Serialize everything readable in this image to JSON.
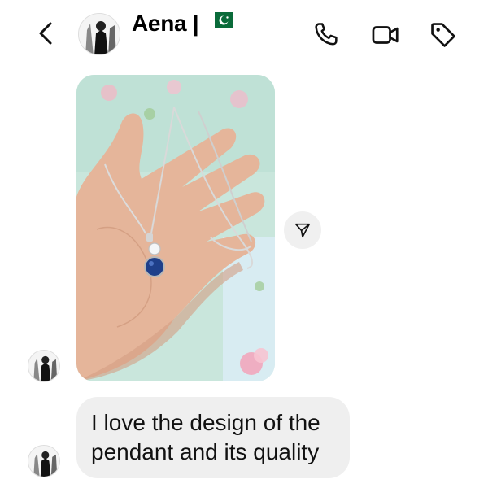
{
  "header": {
    "contact_name": "Aena |",
    "flag_icon": "pakistan-flag-icon",
    "back_icon": "chevron-left-icon",
    "call_icon": "phone-icon",
    "video_icon": "video-camera-icon",
    "tag_icon": "tag-icon"
  },
  "messages": [
    {
      "type": "image",
      "description_icon": "photo-message",
      "share_icon": "send-arrow-icon"
    },
    {
      "type": "text",
      "text": "I love the design of the pendant and its quality"
    }
  ],
  "colors": {
    "bubble_bg": "#efefef",
    "share_bg": "#f0f0f0",
    "pendant_stone": "#1f3f8a",
    "skin": "#e4b39a",
    "background_mint": "#b7ddd4"
  }
}
